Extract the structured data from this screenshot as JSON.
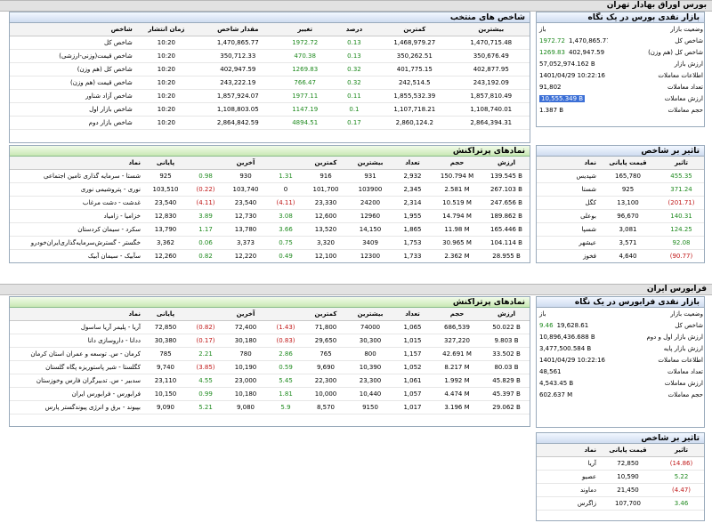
{
  "tse": {
    "title": "بورس اوراق بهادار تهران",
    "indices": {
      "title": "شاخص های منتخب",
      "headers": [
        "شاخص",
        "زمان انتشار",
        "مقدار شاخص",
        "تغییر",
        "درصد",
        "کمترین",
        "بیشترین"
      ],
      "rows": [
        {
          "name": "شاخص کل",
          "time": "10:20",
          "value": "1,470,865.77",
          "change": "1972.72",
          "pct": "0.13",
          "low": "1,468,979.27",
          "high": "1,470,715.48",
          "dir": "pos"
        },
        {
          "name": "شاخص قیمت(وزنی-ارزشی)",
          "time": "10:20",
          "value": "350,712.33",
          "change": "470.38",
          "pct": "0.13",
          "low": "350,262.51",
          "high": "350,676.49",
          "dir": "pos"
        },
        {
          "name": "شاخص کل (هم وزن)",
          "time": "10:20",
          "value": "402,947.59",
          "change": "1269.83",
          "pct": "0.32",
          "low": "401,775.15",
          "high": "402,877.95",
          "dir": "pos"
        },
        {
          "name": "شاخص قیمت (هم وزن)",
          "time": "10:20",
          "value": "243,222.19",
          "change": "766.47",
          "pct": "0.32",
          "low": "242,514.5",
          "high": "243,192.09",
          "dir": "pos"
        },
        {
          "name": "شاخص آزاد شناور",
          "time": "10:20",
          "value": "1,857,924.07",
          "change": "1977.11",
          "pct": "0.11",
          "low": "1,855,532.39",
          "high": "1,857,810.49",
          "dir": "pos"
        },
        {
          "name": "شاخص بازار اول",
          "time": "10:20",
          "value": "1,108,803.05",
          "change": "1147.19",
          "pct": "0.1",
          "low": "1,107,718.21",
          "high": "1,108,740.01",
          "dir": "pos"
        },
        {
          "name": "شاخص بازار دوم",
          "time": "10:20",
          "value": "2,864,842.59",
          "change": "4894.51",
          "pct": "0.17",
          "low": "2,860,124.2",
          "high": "2,864,394.31",
          "dir": "pos"
        }
      ]
    },
    "snapshot": {
      "title": "بازار نقدی بورس در یک نگاه",
      "rows": [
        {
          "label": "وضعیت بازار",
          "value": "باز"
        },
        {
          "label": "شاخص کل",
          "value": "1,470,865.77",
          "change": "1972.72"
        },
        {
          "label": "شاخص کل (هم وزن)",
          "value": "402,947.59",
          "change": "1269.83"
        },
        {
          "label": "ارزش بازار",
          "value": "57,052,974.162 B"
        },
        {
          "label": "اطلاعات معاملات",
          "value": "1401/04/29 10:22:16"
        },
        {
          "label": "تعداد معاملات",
          "value": "91,802"
        },
        {
          "label": "ارزش معاملات",
          "value": "10,555.349 B",
          "highlight": true
        },
        {
          "label": "حجم معاملات",
          "value": "1.387 B",
          "highlight_label": true
        }
      ]
    },
    "top": {
      "title": "نمادهای پرتراکنش",
      "headers": [
        "نماد",
        "پایانی",
        "",
        "آخرین",
        "",
        "کمترین",
        "بیشترین",
        "تعداد",
        "حجم",
        "ارزش"
      ],
      "rows": [
        {
          "name": "شستا - سرمایه گذاری تامین اجتماعی",
          "close": "925",
          "cch": "0.98",
          "last": "930",
          "lch": "1.31",
          "low": "916",
          "high": "931",
          "count": "2,932",
          "vol": "150.794 M",
          "val": "139.545 B",
          "cdir": "pos",
          "ldir": "pos"
        },
        {
          "name": "نوری - پتروشیمی نوری",
          "close": "103,510",
          "cch": "(0.22)",
          "last": "103,740",
          "lch": "0",
          "low": "101,700",
          "high": "103900",
          "count": "2,345",
          "vol": "2.581 M",
          "val": "267.103 B",
          "cdir": "neg",
          "ldir": ""
        },
        {
          "name": "غدشت - دشت مرغاب",
          "close": "23,540",
          "cch": "(4.11)",
          "last": "23,540",
          "lch": "(4.11)",
          "low": "23,330",
          "high": "24200",
          "count": "2,314",
          "vol": "10.519 M",
          "val": "247.656 B",
          "cdir": "neg",
          "ldir": "neg"
        },
        {
          "name": "خزامیا - زامیاد",
          "close": "12,830",
          "cch": "3.89",
          "last": "12,730",
          "lch": "3.08",
          "low": "12,600",
          "high": "12960",
          "count": "1,955",
          "vol": "14.794 M",
          "val": "189.862 B",
          "cdir": "pos",
          "ldir": "pos"
        },
        {
          "name": "سکرد - سیمان کردستان",
          "close": "13,790",
          "cch": "1.17",
          "last": "13,780",
          "lch": "3.66",
          "low": "13,520",
          "high": "14,150",
          "count": "1,865",
          "vol": "11.98 M",
          "val": "165.446 B",
          "cdir": "pos",
          "ldir": "pos"
        },
        {
          "name": "خگستر - گسترش‌سرمایه‌گذاری‌ایران‌خودرو",
          "close": "3,362",
          "cch": "0.06",
          "last": "3,373",
          "lch": "0.75",
          "low": "3,320",
          "high": "3409",
          "count": "1,753",
          "vol": "30.965 M",
          "val": "104.114 B",
          "cdir": "pos",
          "ldir": "pos"
        },
        {
          "name": "سآبیک - سیمان آبیک",
          "close": "12,260",
          "cch": "0.82",
          "last": "12,220",
          "lch": "0.49",
          "low": "12,100",
          "high": "12300",
          "count": "1,733",
          "vol": "2.362 M",
          "val": "28.955 B",
          "cdir": "pos",
          "ldir": "pos"
        }
      ]
    },
    "impact": {
      "title": "تاثیر بر شاخص",
      "headers": [
        "نماد",
        "قیمت پایانی",
        "تاثیر"
      ],
      "rows": [
        {
          "name": "شپدیس",
          "price": "165,780",
          "eff": "455.35",
          "dir": "pos"
        },
        {
          "name": "شستا",
          "price": "925",
          "eff": "371.24",
          "dir": "pos"
        },
        {
          "name": "کگل",
          "price": "13,100",
          "eff": "(201.71)",
          "dir": "neg"
        },
        {
          "name": "بوعلی",
          "price": "96,670",
          "eff": "140.31",
          "dir": "pos"
        },
        {
          "name": "شسپا",
          "price": "3,081",
          "eff": "124.25",
          "dir": "pos"
        },
        {
          "name": "عیشهر",
          "price": "3,571",
          "eff": "92.08",
          "dir": "pos"
        },
        {
          "name": "فخوز",
          "price": "4,640",
          "eff": "(90.77)",
          "dir": "neg"
        }
      ]
    }
  },
  "ifb": {
    "title": "فرابورس ایران",
    "top": {
      "title": "نمادهای پرتراکنش",
      "headers": [
        "نماد",
        "پایانی",
        "",
        "آخرین",
        "",
        "کمترین",
        "بیشترین",
        "تعداد",
        "حجم",
        "ارزش"
      ],
      "rows": [
        {
          "name": "آریا - پلیمر آریا ساسول",
          "close": "72,850",
          "cch": "(0.82)",
          "last": "72,400",
          "lch": "(1.43)",
          "low": "71,800",
          "high": "74000",
          "count": "1,065",
          "vol": "686,539",
          "val": "50.022 B",
          "cdir": "neg",
          "ldir": "neg"
        },
        {
          "name": "ددانا - داروسازی دانا",
          "close": "30,380",
          "cch": "(0.17)",
          "last": "30,180",
          "lch": "(0.83)",
          "low": "29,650",
          "high": "30,300",
          "count": "1,015",
          "vol": "327,220",
          "val": "9.803 B",
          "cdir": "neg",
          "ldir": "neg"
        },
        {
          "name": "کرمان - س. توسعه و عمران استان کرمان",
          "close": "785",
          "cch": "2.21",
          "last": "780",
          "lch": "2.86",
          "low": "765",
          "high": "800",
          "count": "1,157",
          "vol": "42.691 M",
          "val": "33.502 B",
          "cdir": "pos",
          "ldir": "pos"
        },
        {
          "name": "کگلستا - شیر پاستوریزه پگاه گلستان",
          "close": "9,740",
          "cch": "(3.85)",
          "last": "10,190",
          "lch": "0.59",
          "low": "9,690",
          "high": "10,390",
          "count": "1,052",
          "vol": "8.217 M",
          "val": "80.03 B",
          "cdir": "neg",
          "ldir": "pos"
        },
        {
          "name": "سدبیر - س. تدبیرگران فارس وخوزستان",
          "close": "23,110",
          "cch": "4.55",
          "last": "23,000",
          "lch": "5.45",
          "low": "22,300",
          "high": "23,300",
          "count": "1,061",
          "vol": "1.992 M",
          "val": "45.829 B",
          "cdir": "pos",
          "ldir": "pos"
        },
        {
          "name": "فرابورس - فرابورس ایران",
          "close": "10,150",
          "cch": "0.99",
          "last": "10,180",
          "lch": "1.81",
          "low": "10,000",
          "high": "10,440",
          "count": "1,057",
          "vol": "4.474 M",
          "val": "45.397 B",
          "cdir": "pos",
          "ldir": "pos"
        },
        {
          "name": "بپیوند - برق و انرژی پیوندگستر پارس",
          "close": "9,090",
          "cch": "5.21",
          "last": "9,080",
          "lch": "5.9",
          "low": "8,570",
          "high": "9150",
          "count": "1,017",
          "vol": "3.196 M",
          "val": "29.062 B",
          "cdir": "pos",
          "ldir": "pos"
        }
      ]
    },
    "snapshot": {
      "title": "بازار نقدی فرابورس در یک نگاه",
      "rows": [
        {
          "label": "وضعیت بازار",
          "value": "باز"
        },
        {
          "label": "شاخص کل",
          "value": "19,628.61",
          "change": "9.46"
        },
        {
          "label": "ارزش بازار اول و دوم",
          "value": "10,896,436.688 B"
        },
        {
          "label": "ارزش بازار پایه",
          "value": "3,477,500.584 B"
        },
        {
          "label": "اطلاعات معاملات",
          "value": "1401/04/29 10:22:16"
        },
        {
          "label": "تعداد معاملات",
          "value": "48,561"
        },
        {
          "label": "ارزش معاملات",
          "value": "4,543.45 B"
        },
        {
          "label": "حجم معاملات",
          "value": "602.637 M"
        }
      ]
    },
    "impact": {
      "title": "تاثیر بر شاخص",
      "headers": [
        "نماد",
        "قیمت پایانی",
        "تاثیر"
      ],
      "rows": [
        {
          "name": "آریا",
          "price": "72,850",
          "eff": "(14.86)",
          "dir": "neg"
        },
        {
          "name": "عصیو",
          "price": "10,590",
          "eff": "5.22",
          "dir": "pos"
        },
        {
          "name": "دماوند",
          "price": "21,450",
          "eff": "(4.47)",
          "dir": "neg"
        },
        {
          "name": "زاگرس",
          "price": "107,700",
          "eff": "3.46",
          "dir": "pos"
        }
      ]
    }
  }
}
